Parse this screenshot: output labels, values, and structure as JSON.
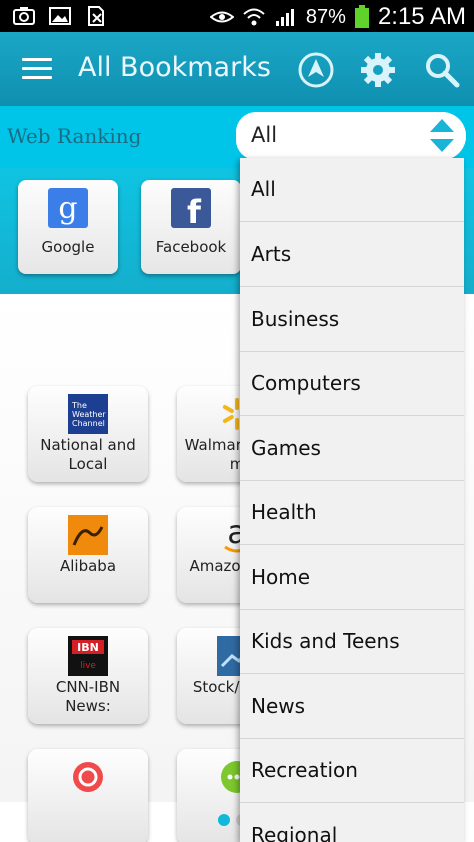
{
  "status_bar": {
    "battery": "87%",
    "time": "2:15 AM",
    "icons": [
      "camera-icon",
      "gallery-icon",
      "no-sim-icon",
      "eye-icon",
      "wifi-icon",
      "signal-icon",
      "battery-icon"
    ]
  },
  "appbar": {
    "title": "All Bookmarks",
    "icons": [
      "menu-icon",
      "navigation-icon",
      "gear-icon",
      "search-icon"
    ]
  },
  "filter": {
    "label": "Web Ranking",
    "selected": "All"
  },
  "top_sites": [
    {
      "label": "Google",
      "icon": "google-logo"
    },
    {
      "label": "Facebook",
      "icon": "facebook-logo"
    }
  ],
  "bookmarks": [
    {
      "label": "National and Local",
      "icon": "weather-channel-logo"
    },
    {
      "label": "Walmart Save m",
      "icon": "walmart-logo"
    },
    {
      "label": "Alibaba",
      "icon": "alibaba-logo"
    },
    {
      "label": "Amazon Onli",
      "icon": "amazon-logo"
    },
    {
      "label": "CNN-IBN News:",
      "icon": "ibn-live-logo"
    },
    {
      "label": "Stock/ Mark",
      "icon": "stock-market-logo"
    },
    {
      "label": "",
      "icon": "red-app-logo"
    },
    {
      "label": "",
      "icon": "green-chat-logo"
    }
  ],
  "page_indicator": {
    "count": 2,
    "active": 0
  },
  "dropdown": {
    "options": [
      "All",
      "Arts",
      "Business",
      "Computers",
      "Games",
      "Health",
      "Home",
      "Kids and Teens",
      "News",
      "Recreation",
      "Regional"
    ]
  },
  "colors": {
    "appbar": "#1ba7c6",
    "filter_bar": "#00c5e9",
    "accent": "#12b8d8"
  }
}
